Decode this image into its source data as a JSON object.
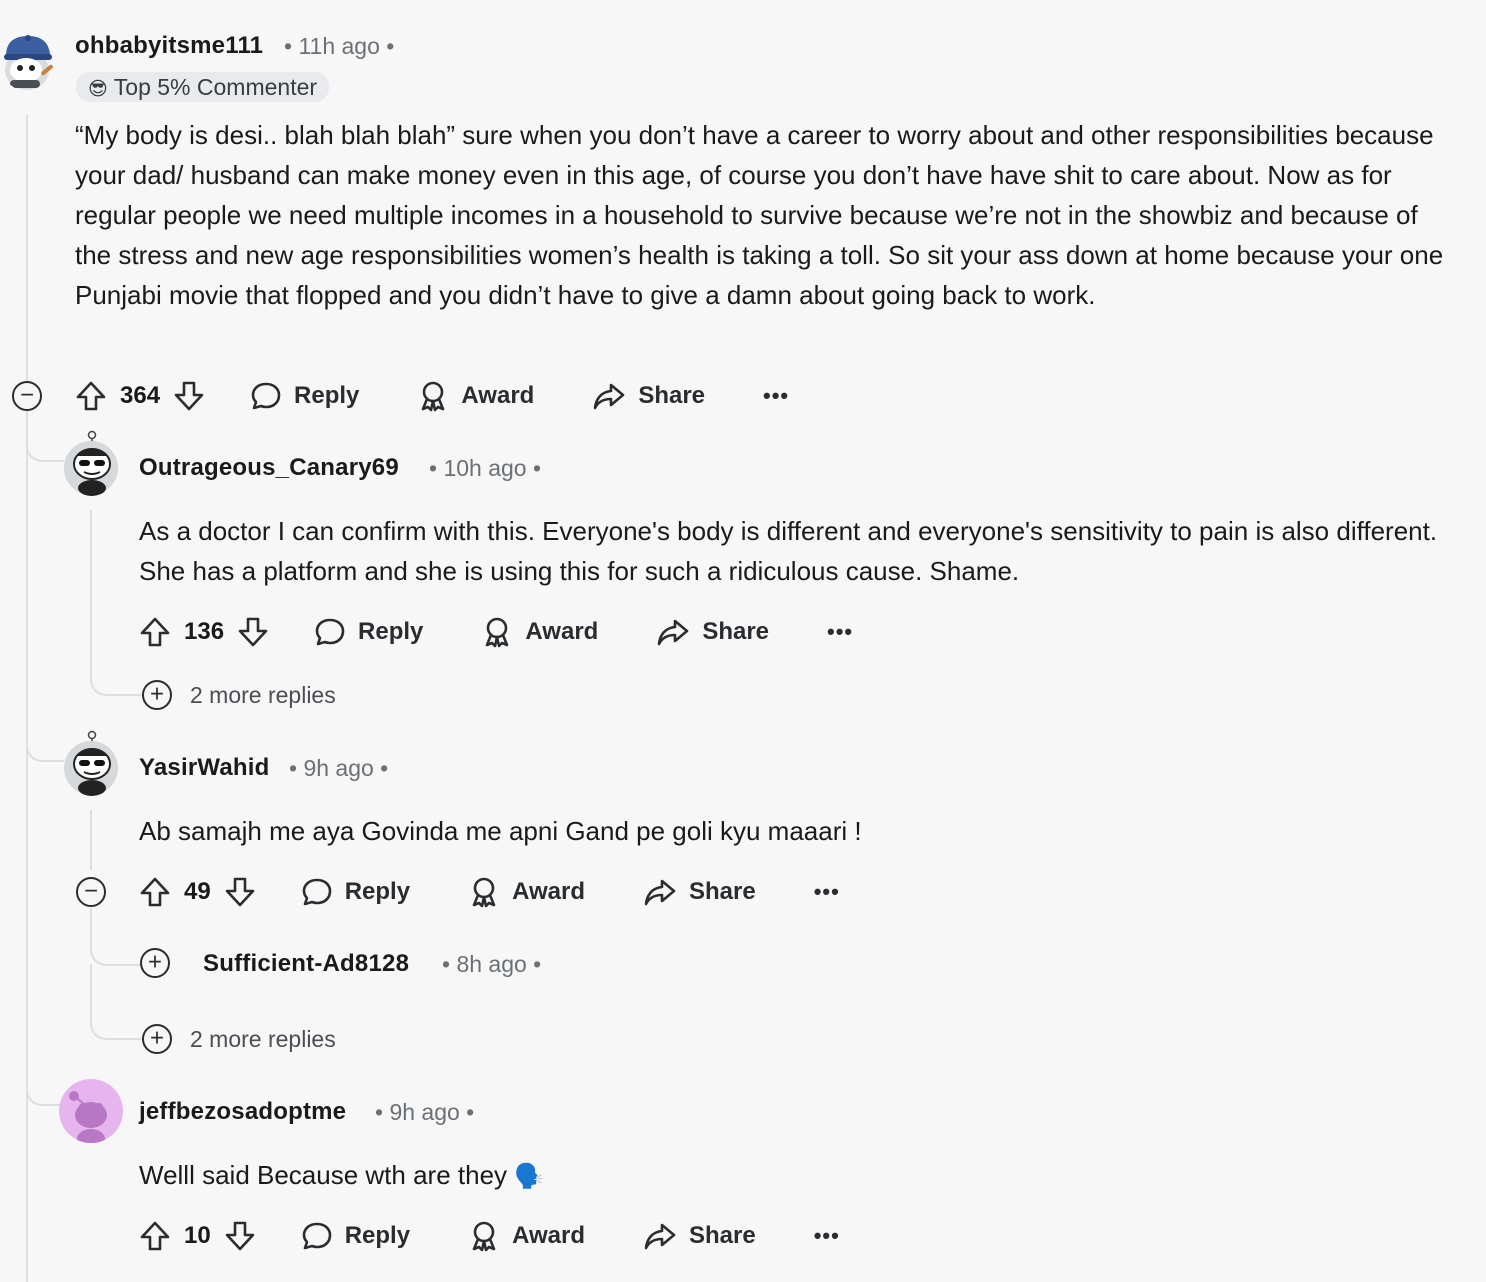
{
  "comments": [
    {
      "username": "ohbabyitsme111",
      "time": "• 11h ago •",
      "flair": "Top 5% Commenter",
      "body": "“My body is desi.. blah blah blah” sure when you don’t have a career to worry about and other responsibilities because your dad/ husband can make money even in this age, of course you don’t have have shit to care about. Now as for regular people we need multiple incomes in a household to survive because we’re not in the showbiz and because of the stress and new age responsibilities women’s health is taking a toll. So sit your ass down at home because your one Punjabi movie that flopped and you didn’t have to give a damn about going back to work.",
      "votes": "364"
    },
    {
      "username": "Outrageous_Canary69",
      "time": "• 10h ago •",
      "body": "As a doctor I can confirm with this. Everyone's body is different and everyone's sensitivity to pain is also different. She has a platform and she is using this for such a ridiculous cause. Shame.",
      "votes": "136",
      "more_replies": "2 more replies"
    },
    {
      "username": "YasirWahid",
      "time": "• 9h ago •",
      "body": "Ab samajh me aya Govinda me apni Gand pe goli kyu maaari !",
      "votes": "49",
      "collapsed_reply": {
        "username": "Sufficient-Ad8128",
        "time": "• 8h ago •"
      },
      "more_replies": "2 more replies"
    },
    {
      "username": "jeffbezosadoptme",
      "time": "• 9h ago •",
      "body": "Welll said Because wth are they",
      "body_emoji": "🗣️",
      "votes": "10"
    }
  ],
  "actions": {
    "reply": "Reply",
    "award": "Award",
    "share": "Share",
    "more": "•••"
  },
  "icons": {
    "collapse": "−",
    "expand": "+",
    "flair_emoji": "😎"
  },
  "colors": {
    "background": "#f7f7f8",
    "text": "#1a1a1b",
    "muted": "#6b7075",
    "thread": "#dcdfe2",
    "avatar_purple": "#e8b8f0"
  }
}
